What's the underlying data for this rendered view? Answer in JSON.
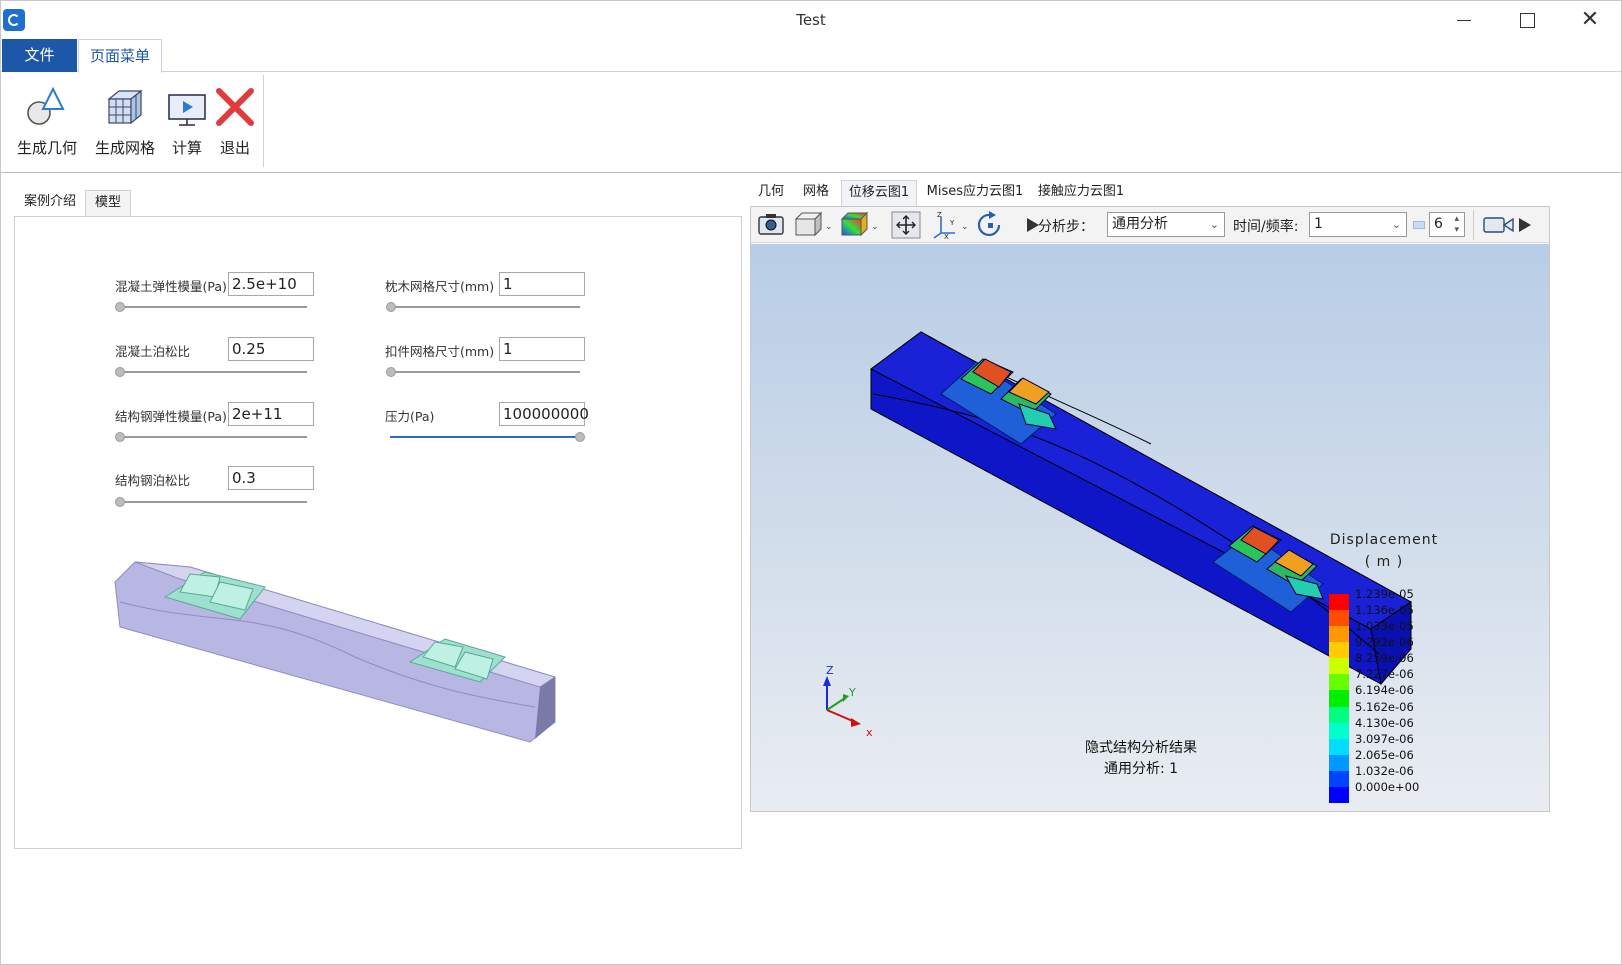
{
  "window": {
    "title": "Test"
  },
  "menu": {
    "tabs": [
      "文件",
      "页面菜单"
    ]
  },
  "ribbon": {
    "buttons": [
      "生成几何",
      "生成网格",
      "计算",
      "退出"
    ]
  },
  "left_panel": {
    "tabs": [
      "案例介绍",
      "模型"
    ],
    "params": [
      {
        "label": "混凝土弹性模量(Pa)",
        "value": "2.5e+10",
        "slider": 0
      },
      {
        "label": "混凝土泊松比",
        "value": "0.25",
        "slider": 0
      },
      {
        "label": "结构钢弹性模量(Pa)",
        "value": "2e+11",
        "slider": 0
      },
      {
        "label": "结构钢泊松比",
        "value": "0.3",
        "slider": 0
      },
      {
        "label": "枕木网格尺寸(mm)",
        "value": "1",
        "slider": 0
      },
      {
        "label": "扣件网格尺寸(mm)",
        "value": "1",
        "slider": 0
      },
      {
        "label": "压力(Pa)",
        "value": "100000000",
        "slider": 1
      }
    ]
  },
  "right_panel": {
    "tabs": [
      "几何",
      "网格",
      "位移云图1",
      "Mises应力云图1",
      "接触应力云图1"
    ],
    "toolbar": {
      "step_label": "分析步：",
      "step_value": "通用分析",
      "time_label": "时间/频率:",
      "time_value": "1",
      "spin_value": "6"
    },
    "legend": {
      "title": "Displacement",
      "unit": "( m )",
      "labels": [
        "1.239e-05",
        "1.136e-05",
        "1.033e-05",
        "9.292e-06",
        "8.259e-06",
        "7.227e-06",
        "6.194e-06",
        "5.162e-06",
        "4.130e-06",
        "3.097e-06",
        "2.065e-06",
        "1.032e-06",
        "0.000e+00"
      ],
      "colors": [
        "#ff0000",
        "#ff4d00",
        "#ff9900",
        "#ffcc00",
        "#ccff00",
        "#66ff00",
        "#00ee00",
        "#00ff80",
        "#00ffcc",
        "#00ddff",
        "#0099ff",
        "#0044ff",
        "#0000ff"
      ]
    },
    "result": {
      "line1": "隐式结构分析结果",
      "line2": "通用分析: 1"
    },
    "triad": {
      "x": "x",
      "y": "Y",
      "z": "Z"
    }
  }
}
